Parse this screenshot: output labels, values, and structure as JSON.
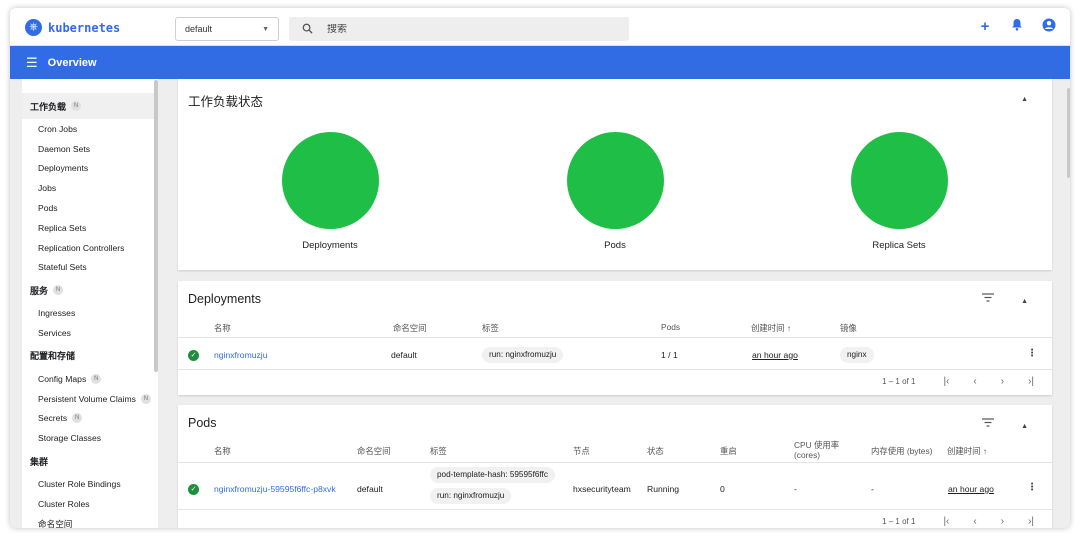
{
  "app": {
    "title": "kubernetes",
    "page_title": "Overview"
  },
  "colors": {
    "brand": "#326ce5",
    "status_ok": "#1fbe46"
  },
  "namespace": {
    "selected": "default"
  },
  "search": {
    "placeholder": "搜索"
  },
  "top_actions": [
    {
      "icon": "plus-icon",
      "glyph": "+"
    },
    {
      "icon": "bell-icon",
      "glyph": "🔔"
    },
    {
      "icon": "account-icon",
      "glyph": "◉"
    }
  ],
  "sidebar": {
    "sections": [
      {
        "label": "工作负载",
        "badge": "N",
        "items": [
          "Cron Jobs",
          "Daemon Sets",
          "Deployments",
          "Jobs",
          "Pods",
          "Replica Sets",
          "Replication Controllers",
          "Stateful Sets"
        ]
      },
      {
        "label": "服务",
        "badge": "N",
        "items": [
          "Ingresses",
          "Services"
        ]
      },
      {
        "label": "配置和存储",
        "badge": "",
        "items": [
          {
            "label": "Config Maps",
            "badge": "N"
          },
          {
            "label": "Persistent Volume Claims",
            "badge": "N"
          },
          {
            "label": "Secrets",
            "badge": "N"
          },
          {
            "label": "Storage Classes",
            "badge": ""
          }
        ]
      },
      {
        "label": "集群",
        "badge": "",
        "items": [
          "Cluster Role Bindings",
          "Cluster Roles",
          "命名空间"
        ]
      }
    ]
  },
  "workload_status": {
    "title": "工作负载状态",
    "items": [
      {
        "label": "Deployments"
      },
      {
        "label": "Pods"
      },
      {
        "label": "Replica Sets"
      }
    ]
  },
  "deployments": {
    "title": "Deployments",
    "columns": [
      "名称",
      "命名空间",
      "标签",
      "Pods",
      "创建时间 ↑",
      "镜像"
    ],
    "rows": [
      {
        "name": "nginxfromuzju",
        "namespace": "default",
        "label": "run: nginxfromuzju",
        "pods": "1 / 1",
        "created": "an hour ago",
        "image": "nginx"
      }
    ],
    "pagination": "1 – 1 of 1"
  },
  "pods": {
    "title": "Pods",
    "columns": [
      "名称",
      "命名空间",
      "标签",
      "节点",
      "状态",
      "重启",
      "CPU 使用率",
      "(cores)",
      "内存使用 (bytes)",
      "创建时间 ↑"
    ],
    "rows": [
      {
        "name": "nginxfromuzju-59595f6ffc-p8xvk",
        "namespace": "default",
        "labels": [
          "pod-template-hash: 59595f6ffc",
          "run: nginxfromuzju"
        ],
        "node": "hxsecurityteam",
        "status": "Running",
        "restarts": "0",
        "cpu": "-",
        "memory": "-",
        "created": "an hour ago"
      }
    ],
    "pagination": "1 – 1 of 1"
  }
}
